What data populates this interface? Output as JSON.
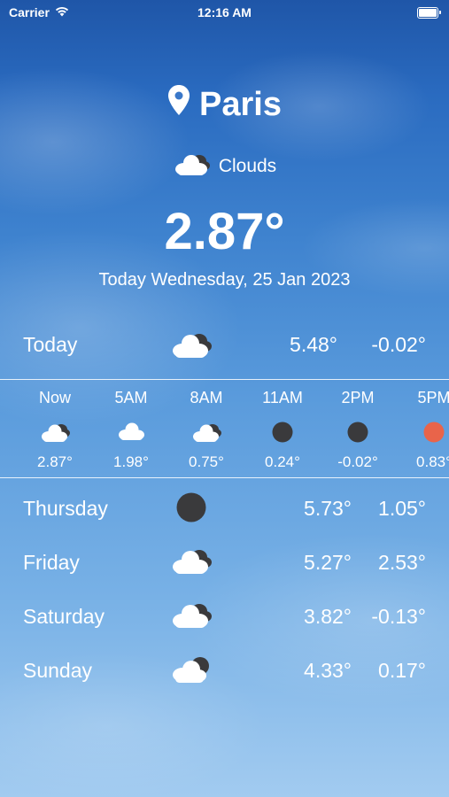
{
  "status_bar": {
    "carrier": "Carrier",
    "time": "12:16 AM"
  },
  "location": {
    "city": "Paris",
    "icon": "location-pin-icon"
  },
  "current": {
    "condition": "Clouds",
    "condition_icon": "cloud-icon",
    "temperature": "2.87°",
    "date": "Today Wednesday, 25 Jan 2023"
  },
  "today": {
    "label": "Today",
    "icon": "cloud-icon",
    "high": "5.48°",
    "low": "-0.02°"
  },
  "hourly": [
    {
      "time": "Now",
      "icon": "cloud-icon",
      "temp": "2.87°"
    },
    {
      "time": "5AM",
      "icon": "cloud-small-icon",
      "temp": "1.98°"
    },
    {
      "time": "8AM",
      "icon": "cloud-icon",
      "temp": "0.75°"
    },
    {
      "time": "11AM",
      "icon": "dark-circle-icon",
      "temp": "0.24°"
    },
    {
      "time": "2PM",
      "icon": "dark-circle-icon",
      "temp": "-0.02°"
    },
    {
      "time": "5PM",
      "icon": "sun-icon",
      "temp": "0.83°"
    }
  ],
  "daily": [
    {
      "day": "Thursday",
      "icon": "dark-circle-icon",
      "high": "5.73°",
      "low": "1.05°"
    },
    {
      "day": "Friday",
      "icon": "cloud-icon",
      "high": "5.27°",
      "low": "2.53°"
    },
    {
      "day": "Saturday",
      "icon": "cloud-icon",
      "high": "3.82°",
      "low": "-0.13°"
    },
    {
      "day": "Sunday",
      "icon": "cloud-moon-icon",
      "high": "4.33°",
      "low": "0.17°"
    }
  ],
  "colors": {
    "sky_top": "#1f56a8",
    "sky_bottom": "#a2cbf0",
    "dark_icon": "#3a3a3c",
    "sun_icon": "#e9644a",
    "text": "#ffffff"
  }
}
